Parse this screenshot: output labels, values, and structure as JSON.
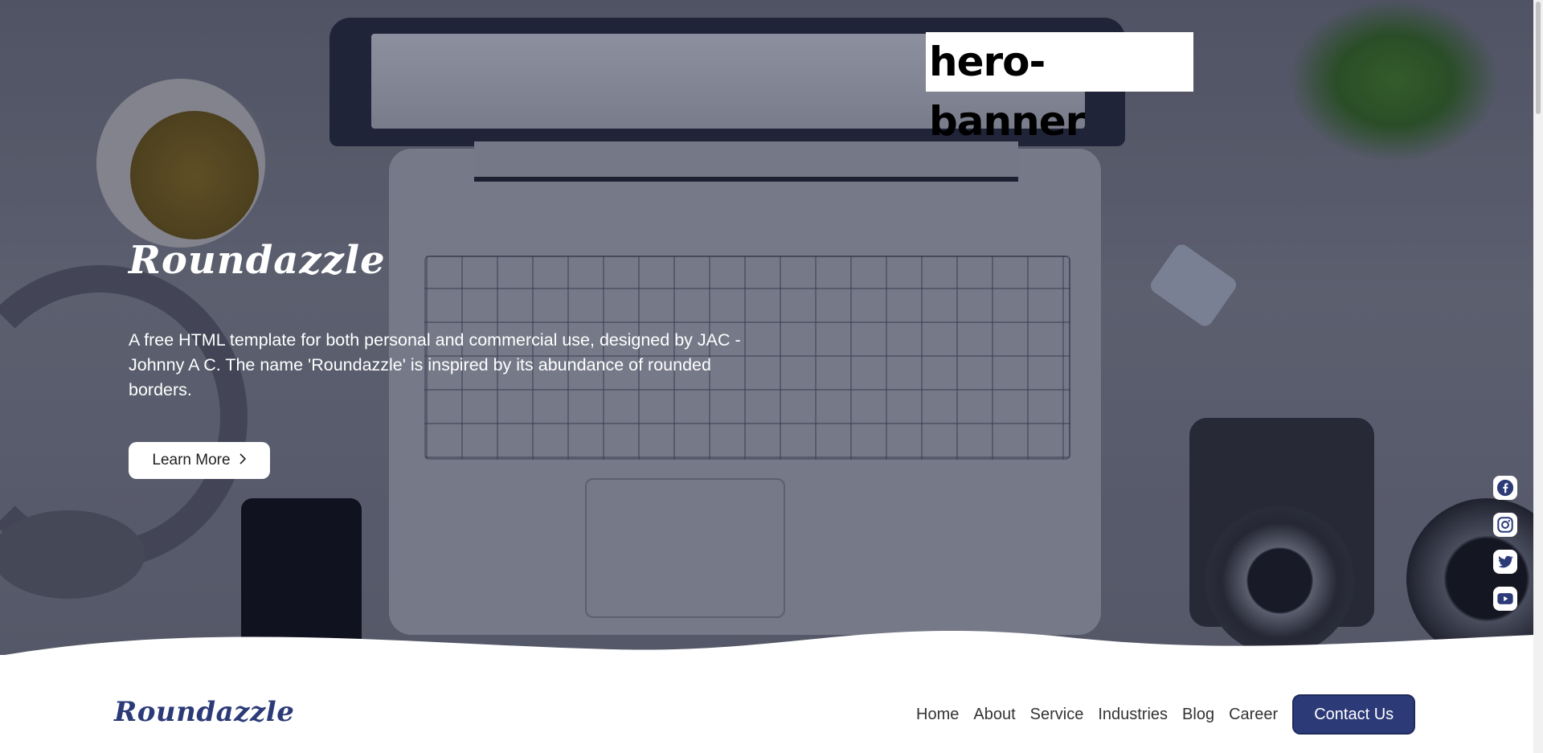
{
  "section_label": "hero-banner",
  "hero": {
    "title": "Roundazzle",
    "description": "A free HTML template for both personal and commercial use, designed by JAC - Johnny A C. The name 'Roundazzle' is inspired by its abundance of rounded borders.",
    "cta_label": "Learn More",
    "cta_icon": "chevron-right-icon"
  },
  "social": [
    {
      "name": "facebook-icon"
    },
    {
      "name": "instagram-icon"
    },
    {
      "name": "twitter-icon"
    },
    {
      "name": "youtube-icon"
    }
  ],
  "navbar": {
    "logo": "Roundazzle",
    "links": [
      "Home",
      "About",
      "Service",
      "Industries",
      "Blog",
      "Career"
    ],
    "contact_label": "Contact Us"
  },
  "colors": {
    "brand": "#2c3a78",
    "white": "#ffffff"
  }
}
